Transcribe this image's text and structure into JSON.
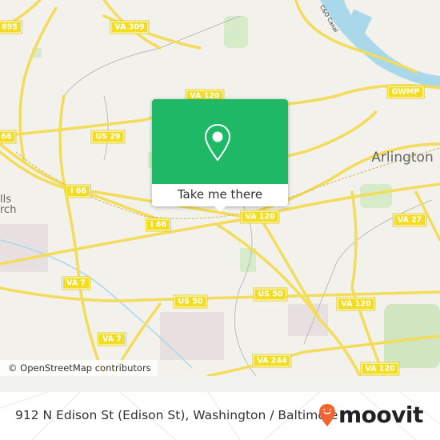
{
  "map": {
    "shields": [
      "695",
      "VA 309",
      "VA 120",
      "GWMP",
      "66",
      "US 29",
      "I 66",
      "I 66",
      "VA 120",
      "VA 27",
      "VA 7",
      "US 50",
      "US 50",
      "VA 120",
      "VA 7",
      "VA 244",
      "VA 120"
    ],
    "places": {
      "arlington": "Arlington",
      "falls_church": "lls\nrch"
    },
    "river_label": "C&O Canal",
    "attribution": "© OpenStreetMap contributors"
  },
  "popup": {
    "button_label": "Take me there",
    "color": "#1fb866"
  },
  "footer": {
    "address": "912 N Edison St (Edison St), Washington / Baltimore",
    "brand": "moovit",
    "brand_color": "#f26430"
  }
}
